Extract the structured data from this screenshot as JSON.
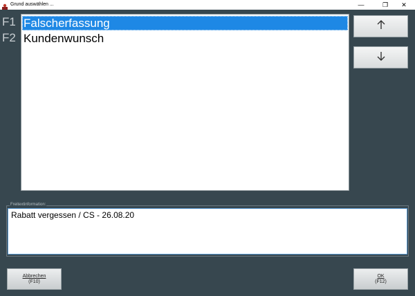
{
  "window": {
    "title": "Grund auswählen ...",
    "minimize_glyph": "—",
    "maximize_glyph": "❐",
    "close_glyph": "✕"
  },
  "reason_list": {
    "items": [
      {
        "key": "F1",
        "label": "Falscherfassung",
        "selected": true
      },
      {
        "key": "F2",
        "label": "Kundenwunsch",
        "selected": false
      }
    ]
  },
  "navigation": {
    "up_icon": "arrow-up-icon",
    "down_icon": "arrow-down-icon"
  },
  "free_text": {
    "group_label": "Freitextinformation:",
    "value": "Rabatt vergessen / CS - 26.08.20"
  },
  "buttons": {
    "cancel": {
      "label": "Abbrechen",
      "shortcut": "(F10)"
    },
    "ok": {
      "label": "OK",
      "shortcut": "(F12)"
    }
  },
  "colors": {
    "background": "#37474f",
    "selection": "#1e88e5"
  }
}
